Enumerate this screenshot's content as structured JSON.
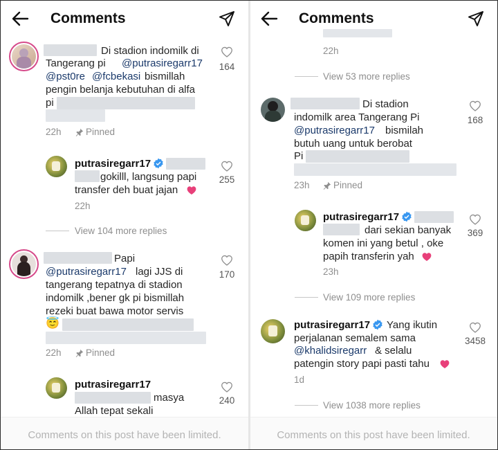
{
  "header": {
    "title": "Comments",
    "back_icon": "arrow-left-icon",
    "share_icon": "send-icon"
  },
  "footer": {
    "text": "Comments on this post have been limited."
  },
  "left": {
    "comment1": {
      "lines": [
        "Di stadion indomilk di",
        "Tangerang pi",
        "@putrasiregarr17",
        "@pst0re",
        "@fcbekasi",
        "bismillah",
        "pengin belanja kebutuhan di alfa",
        "pi"
      ],
      "time": "22h",
      "pinned": "Pinned",
      "likes": "164"
    },
    "reply1": {
      "username": "putrasiregarr17",
      "line1": "gokilll, langsung papi",
      "line2": "transfer deh buat jajan",
      "time": "22h",
      "likes": "255"
    },
    "view_replies1": "View 104 more replies",
    "comment2": {
      "word1": "Papi",
      "mention": "@putrasiregarr17",
      "line2": "lagi JJS di",
      "line3": "tangerang tepatnya di stadion",
      "line4": "indomilk ,bener gk pi bismillah",
      "line5": "rezeki buat bawa motor servis",
      "emoji": "😇",
      "time": "22h",
      "pinned": "Pinned",
      "likes": "170"
    },
    "reply2": {
      "username": "putrasiregarr17",
      "line1": "masya",
      "line2": "Allah tepat sekali",
      "likes": "240"
    }
  },
  "right": {
    "prev_time": "22h",
    "view_replies0": "View 53 more replies",
    "comment1": {
      "line1": "Di stadion",
      "line2": "indomilk area Tangerang Pi",
      "mention": "@putrasiregarr17",
      "line3b": "bismilah",
      "line4": "butuh uang untuk berobat",
      "line5": "Pi",
      "time": "23h",
      "pinned": "Pinned",
      "likes": "168"
    },
    "reply1": {
      "username": "putrasiregarr17",
      "line1": "dari sekian banyak",
      "line2": "komen ini yang betul , oke",
      "line3": "papih transferin yah",
      "time": "23h",
      "likes": "369"
    },
    "view_replies1": "View 109 more replies",
    "comment2": {
      "username": "putrasiregarr17",
      "line1": "Yang ikutin",
      "line2": "perjalanan semalem sama",
      "mention": "@khalidsiregarr",
      "line3b": "& selalu",
      "line4": "patengin story papi pasti tahu",
      "time": "1d",
      "likes": "3458"
    },
    "view_replies2": "View 1038 more replies"
  },
  "colors": {
    "link": "#1b3a6b",
    "heart": "#e8407a",
    "verified": "#3897f0",
    "muted": "#8e8e8e",
    "story_ring": "#d64a8a"
  }
}
